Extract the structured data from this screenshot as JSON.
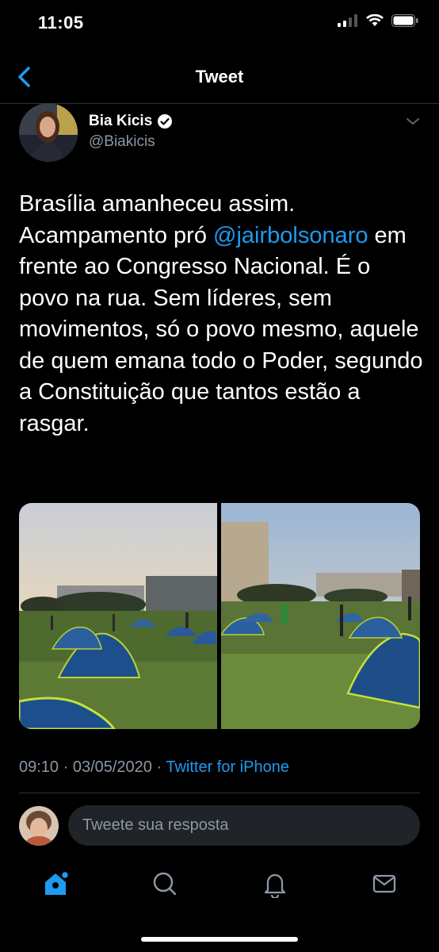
{
  "status_bar": {
    "time": "11:05"
  },
  "header": {
    "title": "Tweet",
    "back_icon": "chevron-left-icon"
  },
  "author": {
    "name": "Bia Kicis",
    "handle": "@Biakicis",
    "verified": true
  },
  "tweet": {
    "text_before": "Brasília amanheceu assim. Acampamento pró ",
    "mention": "@jairbolsonaro",
    "text_after": " em frente ao Congresso Nacional. É o povo na rua. Sem líderes, sem movimentos, só o povo mesmo, aquele de quem emana todo o Poder, segundo a Constituição que tantos estão a rasgar.",
    "timestamp": "09:10 · 03/05/2020 · ",
    "source": "Twitter for iPhone"
  },
  "reply": {
    "placeholder": "Tweete sua resposta"
  },
  "tab_bar": {
    "tabs": [
      "home-icon",
      "search-icon",
      "notifications-icon",
      "messages-icon"
    ]
  },
  "colors": {
    "accent": "#1d9bf0",
    "secondary_text": "#8b98a5",
    "background": "#000000"
  }
}
